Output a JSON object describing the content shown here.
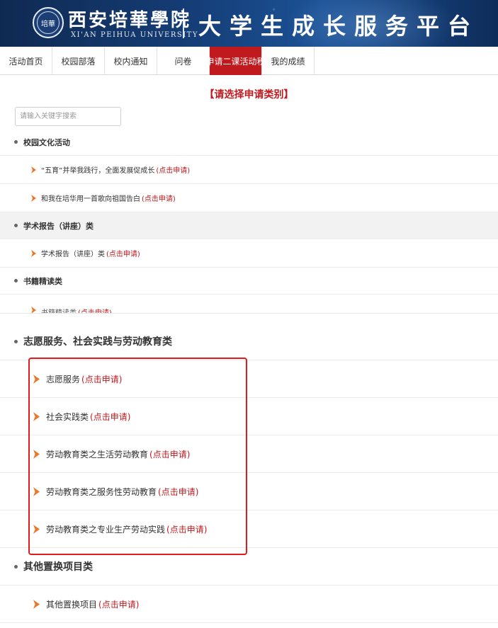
{
  "banner": {
    "university_cn": "西安培華學院",
    "university_en": "XI'AN PEIHUA UNIVERSITY",
    "seal_text": "培華",
    "platform_title": "大学生成长服务平台",
    "bg_color": "#143b73"
  },
  "nav": {
    "items": [
      {
        "label": "活动首页"
      },
      {
        "label": "校园部落"
      },
      {
        "label": "校内通知"
      },
      {
        "label": "问卷"
      },
      {
        "label": "申请二课活动积",
        "active": true
      },
      {
        "label": "我的成绩"
      }
    ],
    "active_color": "#c0191e"
  },
  "page": {
    "title": "【请选择申请类别】",
    "search_placeholder": "请输入关键字搜索",
    "apply_label": "(点击申请)",
    "apply_color": "#c0191e",
    "chevron_color": "#e9782a"
  },
  "upper": {
    "categories": [
      {
        "title": "校园文化活动",
        "items": [
          "“五育”并举我践行，全面发展促成长",
          "和我在培华用一首歌向祖国告白"
        ]
      },
      {
        "title": "学术报告（讲座）类",
        "items": [
          "学术报告（讲座）类"
        ]
      },
      {
        "title": "书籍精读类",
        "items": []
      }
    ],
    "partial_item": "书籍精读类"
  },
  "lower": {
    "categories": [
      {
        "title": "志愿服务、社会实践与劳动教育类",
        "items": [
          "志愿服务",
          "社会实践类",
          "劳动教育类之生活劳动教育",
          "劳动教育类之服务性劳动教育",
          "劳动教育类之专业生产劳动实践"
        ]
      },
      {
        "title": "其他置换项目类",
        "items": [
          "其他置换项目"
        ]
      }
    ],
    "highlight_color": "#e01b1b"
  }
}
